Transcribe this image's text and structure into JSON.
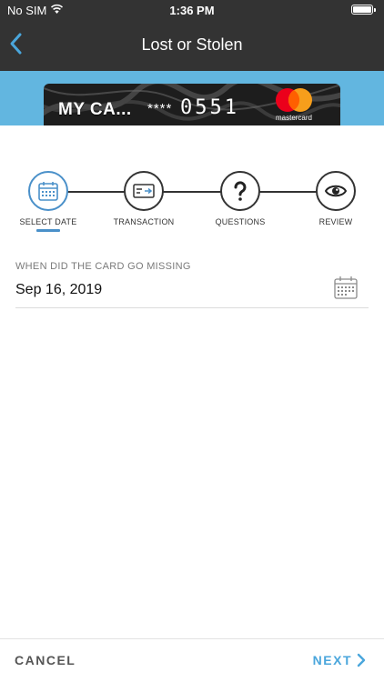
{
  "status_bar": {
    "carrier": "No SIM",
    "time": "1:36 PM"
  },
  "nav": {
    "title": "Lost or Stolen",
    "back_icon": "chevron-left-icon"
  },
  "card": {
    "name": "MY CA...",
    "masked": "****",
    "last4": "0551",
    "network": "mastercard"
  },
  "stepper": {
    "steps": [
      {
        "label": "SELECT DATE",
        "icon": "calendar-icon",
        "active": true
      },
      {
        "label": "TRANSACTION",
        "icon": "card-transaction-icon",
        "active": false
      },
      {
        "label": "QUESTIONS",
        "icon": "question-icon",
        "active": false
      },
      {
        "label": "REVIEW",
        "icon": "eye-icon",
        "active": false
      }
    ]
  },
  "form": {
    "label": "WHEN DID THE CARD GO MISSING",
    "value": "Sep 16, 2019"
  },
  "footer": {
    "cancel": "CANCEL",
    "next": "NEXT"
  },
  "colors": {
    "topbar": "#333333",
    "banner": "#62b6e0",
    "accent": "#4a90c9",
    "next": "#4aa6dc"
  }
}
